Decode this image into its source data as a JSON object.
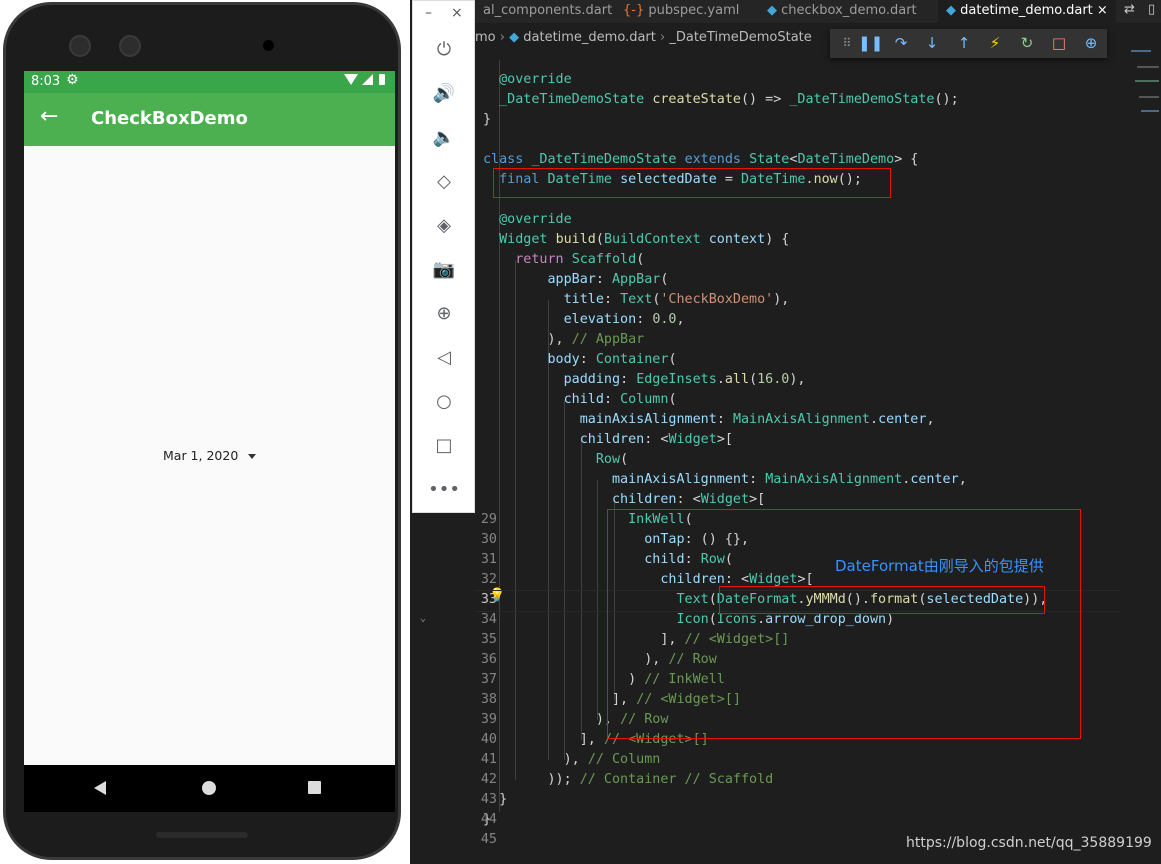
{
  "phone": {
    "status_time": "8:03",
    "app_title": "CheckBoxDemo",
    "date_label": "Mar 1, 2020",
    "colors": {
      "appbar": "#4caf50",
      "statusbar": "#3aa64a"
    }
  },
  "emulator_toolbar": {
    "icons": [
      "power-icon",
      "volume-up-icon",
      "volume-down-icon",
      "rotate-left-icon",
      "rotate-right-icon",
      "camera-icon",
      "zoom-icon",
      "back-icon",
      "home-icon",
      "overview-icon",
      "more-icon"
    ]
  },
  "editor": {
    "tabs": [
      {
        "label": "al_components.dart",
        "active": false
      },
      {
        "label": "pubspec.yaml",
        "active": false
      },
      {
        "label": "checkbox_demo.dart",
        "active": false
      },
      {
        "label": "datetime_demo.dart",
        "active": true
      }
    ],
    "tab_close": "×",
    "breadcrumb": [
      "mo",
      "datetime_demo.dart",
      "_DateTimeDemoState"
    ],
    "annotation": "DateFormat由刚导入的包提供",
    "watermark": "https://blog.csdn.net/qq_35889199",
    "line_numbers": [
      29,
      30,
      31,
      32,
      33,
      34,
      35,
      36,
      37,
      38,
      39,
      40,
      41,
      42,
      43,
      44,
      45
    ]
  }
}
